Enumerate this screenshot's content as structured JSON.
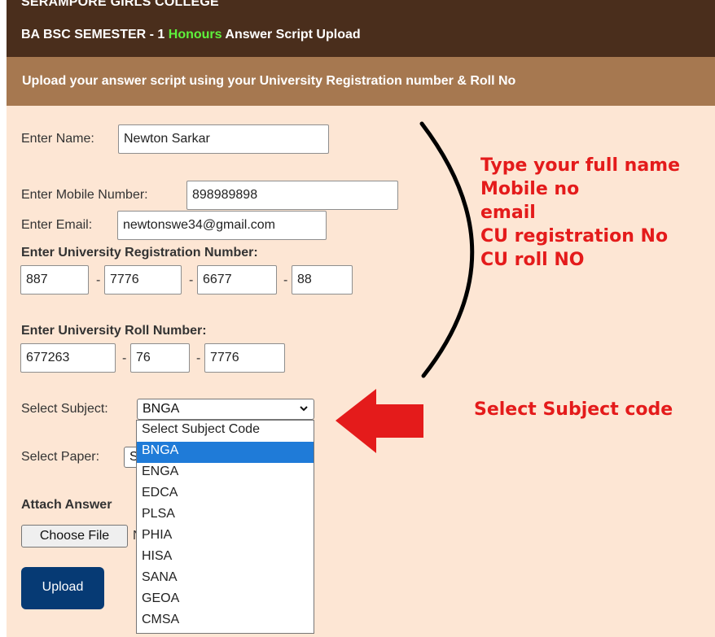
{
  "header": {
    "college": "SERAMPORE GIRLS COLLEGE",
    "title_pre": "BA BSC SEMESTER - 1 ",
    "title_honours": "Honours",
    "title_post": " Answer Script Upload"
  },
  "subheader": "Upload your answer script using your University Registration number & Roll No",
  "form": {
    "name_label": "Enter Name:",
    "name_value": "Newton Sarkar",
    "mobile_label": "Enter Mobile Number:",
    "mobile_value": "898989898",
    "email_label": "Enter Email:",
    "email_value": "newtonswe34@gmail.com",
    "reg_label": "Enter University Registration Number:",
    "reg_values": [
      "887",
      "7776",
      "6677",
      "88"
    ],
    "roll_label": "Enter University Roll Number:",
    "roll_values": [
      "677263",
      "76",
      "7776"
    ],
    "dash": "-",
    "subject_label": "Select Subject:",
    "subject_value": "BNGA",
    "paper_label": "Select Paper:",
    "paper_value_partial": "S",
    "attach_label": "Attach Answer",
    "choose_file": "Choose File",
    "file_status_partial": "N",
    "upload": "Upload"
  },
  "dropdown": {
    "options": [
      "Select Subject Code",
      "BNGA",
      "ENGA",
      "EDCA",
      "PLSA",
      "PHIA",
      "HISA",
      "SANA",
      "GEOA",
      "CMSA"
    ],
    "selected": "BNGA"
  },
  "notes": {
    "lines": [
      "Type your full name",
      "Mobile no",
      "email",
      "CU registration No",
      "CU roll NO"
    ],
    "subject": "Select Subject code"
  },
  "colors": {
    "header_bg": "#4a2e1c",
    "subheader_bg": "#a67850",
    "panel_bg": "#fde6d4",
    "honours": "#5ef23c",
    "annotation_red": "#e41b1b",
    "upload_btn": "#063a74",
    "dropdown_highlight": "#1f7bd8"
  },
  "icons": {
    "select_arrow": "chevron-down-icon"
  }
}
